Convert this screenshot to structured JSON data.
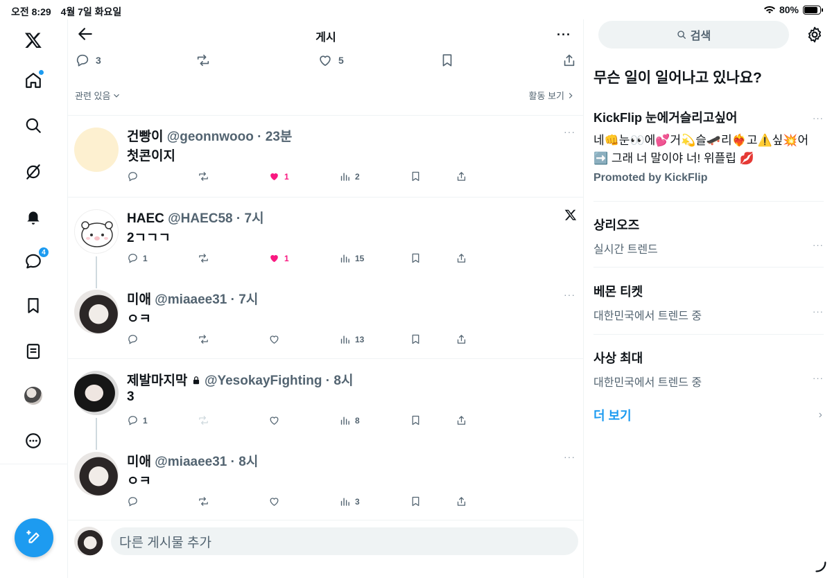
{
  "status": {
    "time": "오전 8:29",
    "date": "4월 7일 화요일",
    "battery": "80%",
    "battery_level": 0.8
  },
  "nav": {
    "messages_badge": "4"
  },
  "header": {
    "title": "게시",
    "more": "···"
  },
  "actions": {
    "replies": "3",
    "likes": "5"
  },
  "sort": {
    "left": "관련 있음",
    "right": "활동 보기"
  },
  "replies": [
    {
      "name": "건빵이",
      "handle": "@geonnwooo",
      "time": "23분",
      "text": "첫콘이지",
      "comments": "",
      "likes": "1",
      "views": "2"
    },
    {
      "name": "HAEC",
      "handle": "@HAEC58",
      "time": "7시",
      "text": "2ㄱㄱㄱ",
      "comments": "1",
      "likes": "1",
      "views": "15"
    },
    {
      "name": "미애",
      "handle": "@miaaee31",
      "time": "7시",
      "text": "ㅇㅋ",
      "comments": "",
      "likes": "",
      "views": "13"
    },
    {
      "name": "제발마지막",
      "handle": "@YesokayFighting",
      "time": "8시",
      "text": "3",
      "comments": "1",
      "likes": "",
      "views": "8"
    },
    {
      "name": "미애",
      "handle": "@miaaee31",
      "time": "8시",
      "text": "ㅇㅋ",
      "comments": "",
      "likes": "",
      "views": "3"
    }
  ],
  "add_post": {
    "placeholder": "다른 게시물 추가"
  },
  "right": {
    "search": "검색",
    "whats_happening": "무슨 일이 일어나고 있나요?",
    "promo": {
      "title": "KickFlip 눈에거슬리고싶어",
      "body": "네👊눈👀에💕거💫슬🛹리❤️‍🔥고⚠️싶💥어 ➡️ 그래 너 말이야 너! 위플립 💋",
      "by": "Promoted by KickFlip"
    },
    "trends": [
      {
        "name": "상리오즈",
        "meta": "실시간 트렌드"
      },
      {
        "name": "베몬 티켓",
        "meta": "대한민국에서 트렌드 중"
      },
      {
        "name": "사상 최대",
        "meta": "대한민국에서 트렌드 중"
      }
    ],
    "show_more": "더 보기"
  },
  "colors": {
    "accent": "#1d9bf0",
    "like": "#f91880",
    "muted": "#536471"
  }
}
